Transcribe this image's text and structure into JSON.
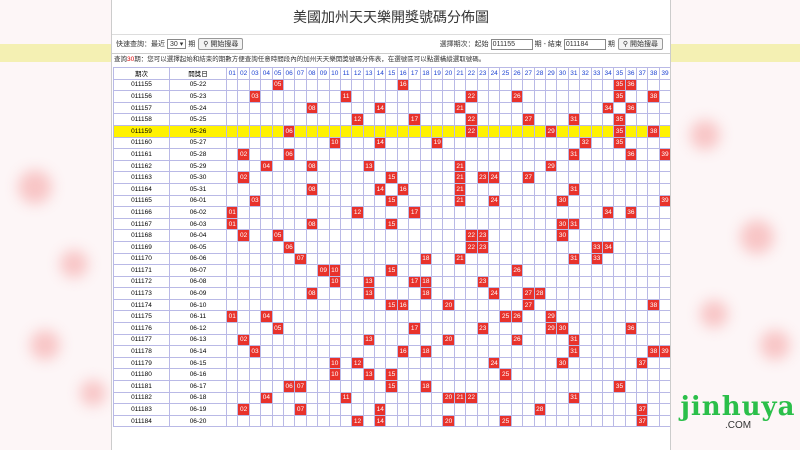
{
  "page": {
    "title": "美國加州天天樂開獎號碼分佈圖"
  },
  "toolbar": {
    "quick_label": "快速查詢：最近",
    "period_value": "30",
    "period_unit": "期",
    "query_button": "開始搜尋",
    "range_label": "選擇期次：起始",
    "start_value": "011155",
    "end_label": "期 - 結束",
    "end_value": "011184",
    "end_unit": "期",
    "range_button": "開始搜尋"
  },
  "notice": {
    "prefix": "查詢",
    "count": "30",
    "text": "期：您可以選擇起始和結束的期數方便查詢任意時間段內的加州天天樂開獎號碼分佈表，在選號區可以點選橫縱選取號碼。"
  },
  "table": {
    "col_period": "期次",
    "col_date": "開獎日",
    "numbers": [
      "01",
      "02",
      "03",
      "04",
      "05",
      "06",
      "07",
      "08",
      "09",
      "10",
      "11",
      "12",
      "13",
      "14",
      "15",
      "16",
      "17",
      "18",
      "19",
      "20",
      "21",
      "22",
      "23",
      "24",
      "25",
      "26",
      "27",
      "28",
      "29",
      "30",
      "31",
      "32",
      "33",
      "34",
      "35",
      "36",
      "37",
      "38",
      "39"
    ],
    "highlight_period": "011159",
    "rows": [
      {
        "period": "011155",
        "date": "05-22",
        "nums": [
          5,
          16,
          35,
          36
        ]
      },
      {
        "period": "011156",
        "date": "05-23",
        "nums": [
          3,
          11,
          22,
          26,
          35,
          38
        ]
      },
      {
        "period": "011157",
        "date": "05-24",
        "nums": [
          8,
          14,
          21,
          34,
          36
        ]
      },
      {
        "period": "011158",
        "date": "05-25",
        "nums": [
          12,
          17,
          22,
          27,
          31,
          35
        ]
      },
      {
        "period": "011159",
        "date": "05-26",
        "nums": [
          6,
          22,
          29,
          35,
          38
        ]
      },
      {
        "period": "011160",
        "date": "05-27",
        "nums": [
          10,
          14,
          19,
          32,
          35
        ]
      },
      {
        "period": "011161",
        "date": "05-28",
        "nums": [
          2,
          6,
          31,
          36,
          39
        ]
      },
      {
        "period": "011162",
        "date": "05-29",
        "nums": [
          4,
          8,
          13,
          21,
          29
        ]
      },
      {
        "period": "011163",
        "date": "05-30",
        "nums": [
          2,
          15,
          21,
          23,
          24,
          27
        ]
      },
      {
        "period": "011164",
        "date": "05-31",
        "nums": [
          8,
          14,
          16,
          21,
          31
        ]
      },
      {
        "period": "011165",
        "date": "06-01",
        "nums": [
          3,
          15,
          21,
          24,
          30,
          39
        ]
      },
      {
        "period": "011166",
        "date": "06-02",
        "nums": [
          1,
          12,
          17,
          34,
          36
        ]
      },
      {
        "period": "011167",
        "date": "06-03",
        "nums": [
          1,
          8,
          15,
          30,
          31
        ]
      },
      {
        "period": "011168",
        "date": "06-04",
        "nums": [
          2,
          5,
          22,
          23,
          30
        ]
      },
      {
        "period": "011169",
        "date": "06-05",
        "nums": [
          6,
          22,
          23,
          33,
          34
        ]
      },
      {
        "period": "011170",
        "date": "06-06",
        "nums": [
          7,
          18,
          21,
          31,
          33
        ]
      },
      {
        "period": "011171",
        "date": "06-07",
        "nums": [
          9,
          10,
          15,
          26
        ]
      },
      {
        "period": "011172",
        "date": "06-08",
        "nums": [
          10,
          13,
          17,
          18,
          23
        ]
      },
      {
        "period": "011173",
        "date": "06-09",
        "nums": [
          8,
          13,
          18,
          24,
          27,
          28
        ]
      },
      {
        "period": "011174",
        "date": "06-10",
        "nums": [
          15,
          16,
          20,
          27,
          38
        ]
      },
      {
        "period": "011175",
        "date": "06-11",
        "nums": [
          1,
          4,
          25,
          26,
          29
        ]
      },
      {
        "period": "011176",
        "date": "06-12",
        "nums": [
          5,
          17,
          23,
          29,
          30,
          36
        ]
      },
      {
        "period": "011177",
        "date": "06-13",
        "nums": [
          2,
          13,
          20,
          26,
          31
        ]
      },
      {
        "period": "011178",
        "date": "06-14",
        "nums": [
          3,
          16,
          18,
          31,
          38,
          39
        ]
      },
      {
        "period": "011179",
        "date": "06-15",
        "nums": [
          10,
          12,
          24,
          30,
          37
        ]
      },
      {
        "period": "011180",
        "date": "06-16",
        "nums": [
          10,
          13,
          15,
          25
        ]
      },
      {
        "period": "011181",
        "date": "06-17",
        "nums": [
          6,
          7,
          15,
          18,
          35
        ]
      },
      {
        "period": "011182",
        "date": "06-18",
        "nums": [
          4,
          11,
          20,
          21,
          22,
          31
        ]
      },
      {
        "period": "011183",
        "date": "06-19",
        "nums": [
          2,
          7,
          14,
          28,
          37
        ]
      },
      {
        "period": "011184",
        "date": "06-20",
        "nums": [
          12,
          14,
          20,
          25,
          37
        ]
      }
    ]
  },
  "watermark": {
    "brand": "jinhuya",
    "suffix": ".COM"
  },
  "colors": {
    "hit": "#e8322b",
    "highlight": "#fff200",
    "header_num": "#1a3fd1"
  }
}
